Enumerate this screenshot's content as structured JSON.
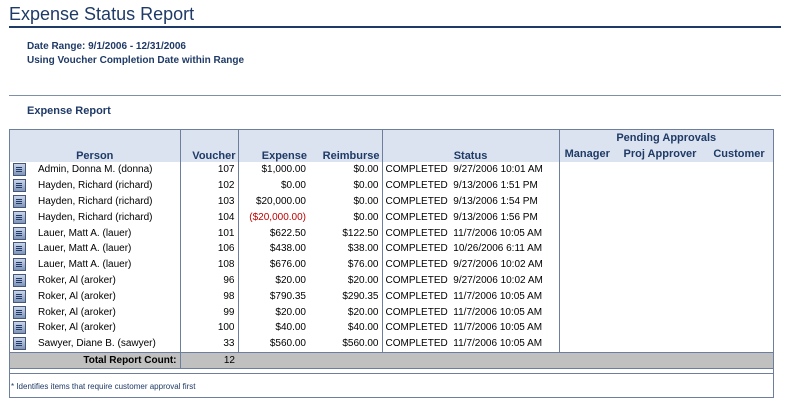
{
  "page": {
    "title": "Expense Status Report",
    "date_range": "Date Range: 9/1/2006 - 12/31/2006",
    "range_basis": "Using Voucher Completion Date within Range",
    "section_title": "Expense Report",
    "footnote": "* Identifies items that require customer approval first"
  },
  "table": {
    "headers": {
      "person": "Person",
      "voucher": "Voucher",
      "expense": "Expense",
      "reimburse": "Reimburse",
      "status": "Status",
      "pending_group": "Pending Approvals",
      "manager": "Manager",
      "proj_approver": "Proj Approver",
      "customer": "Customer"
    },
    "rows": [
      {
        "person": "Admin, Donna M. (donna)",
        "voucher": "107",
        "expense": "$1,000.00",
        "reimburse": "$0.00",
        "status": "COMPLETED",
        "date": "9/27/2006 10:01 AM",
        "negative": false
      },
      {
        "person": "Hayden, Richard (richard)",
        "voucher": "102",
        "expense": "$0.00",
        "reimburse": "$0.00",
        "status": "COMPLETED",
        "date": "9/13/2006 1:51 PM",
        "negative": false
      },
      {
        "person": "Hayden, Richard (richard)",
        "voucher": "103",
        "expense": "$20,000.00",
        "reimburse": "$0.00",
        "status": "COMPLETED",
        "date": "9/13/2006 1:54 PM",
        "negative": false
      },
      {
        "person": "Hayden, Richard (richard)",
        "voucher": "104",
        "expense": "($20,000.00)",
        "reimburse": "$0.00",
        "status": "COMPLETED",
        "date": "9/13/2006 1:56 PM",
        "negative": true
      },
      {
        "person": "Lauer, Matt A. (lauer)",
        "voucher": "101",
        "expense": "$622.50",
        "reimburse": "$122.50",
        "status": "COMPLETED",
        "date": "11/7/2006 10:05 AM",
        "negative": false
      },
      {
        "person": "Lauer, Matt A. (lauer)",
        "voucher": "106",
        "expense": "$438.00",
        "reimburse": "$38.00",
        "status": "COMPLETED",
        "date": "10/26/2006 6:11 AM",
        "negative": false
      },
      {
        "person": "Lauer, Matt A. (lauer)",
        "voucher": "108",
        "expense": "$676.00",
        "reimburse": "$76.00",
        "status": "COMPLETED",
        "date": "9/27/2006 10:02 AM",
        "negative": false
      },
      {
        "person": "Roker, Al (aroker)",
        "voucher": "96",
        "expense": "$20.00",
        "reimburse": "$20.00",
        "status": "COMPLETED",
        "date": "9/27/2006 10:02 AM",
        "negative": false
      },
      {
        "person": "Roker, Al (aroker)",
        "voucher": "98",
        "expense": "$790.35",
        "reimburse": "$290.35",
        "status": "COMPLETED",
        "date": "11/7/2006 10:05 AM",
        "negative": false
      },
      {
        "person": "Roker, Al (aroker)",
        "voucher": "99",
        "expense": "$20.00",
        "reimburse": "$20.00",
        "status": "COMPLETED",
        "date": "11/7/2006 10:05 AM",
        "negative": false
      },
      {
        "person": "Roker, Al (aroker)",
        "voucher": "100",
        "expense": "$40.00",
        "reimburse": "$40.00",
        "status": "COMPLETED",
        "date": "11/7/2006 10:05 AM",
        "negative": false
      },
      {
        "person": "Sawyer, Diane B. (sawyer)",
        "voucher": "33",
        "expense": "$560.00",
        "reimburse": "$560.00",
        "status": "COMPLETED",
        "date": "11/7/2006 10:05 AM",
        "negative": false
      }
    ],
    "total_label": "Total Report Count:",
    "total_count": "12"
  }
}
